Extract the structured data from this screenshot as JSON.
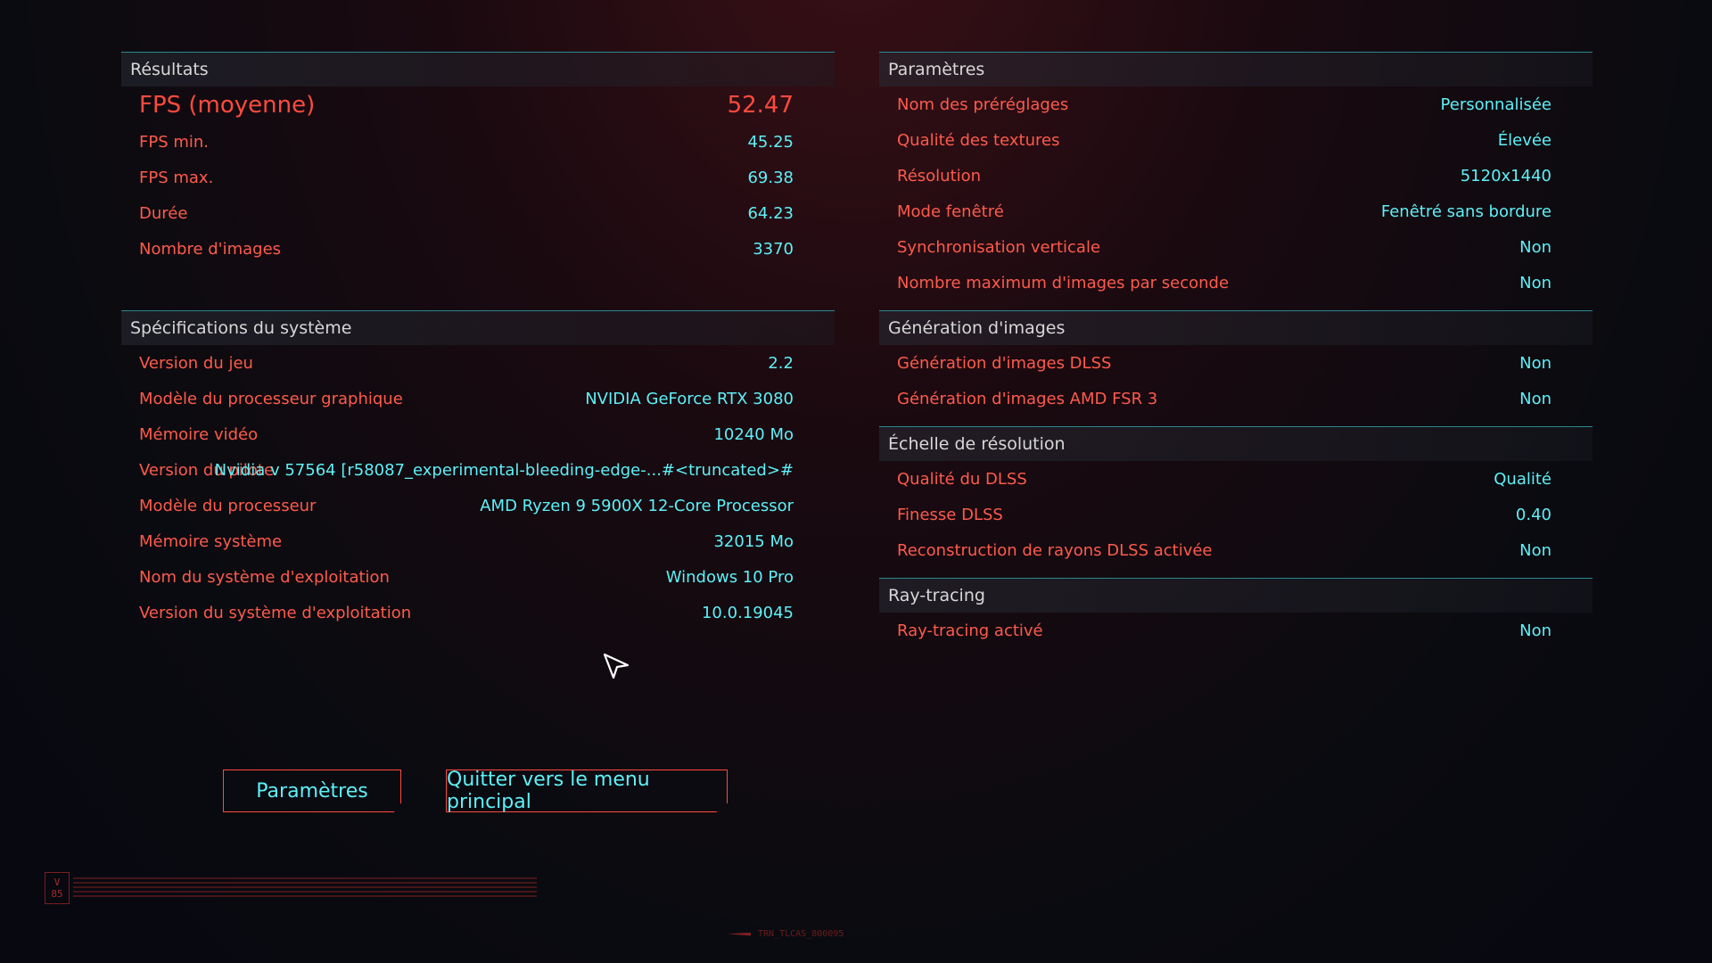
{
  "results": {
    "title": "Résultats",
    "rows": [
      {
        "label": "FPS (moyenne)",
        "value": "52.47"
      },
      {
        "label": "FPS min.",
        "value": "45.25"
      },
      {
        "label": "FPS max.",
        "value": "69.38"
      },
      {
        "label": "Durée",
        "value": "64.23"
      },
      {
        "label": "Nombre d'images",
        "value": "3370"
      }
    ]
  },
  "system": {
    "title": "Spécifications du système",
    "rows": [
      {
        "label": "Version du jeu",
        "value": "2.2"
      },
      {
        "label": "Modèle du processeur graphique",
        "value": "NVIDIA GeForce RTX 3080"
      },
      {
        "label": "Mémoire vidéo",
        "value": "10240 Mo"
      },
      {
        "label": "Version du pilote",
        "value": "Nvidia v 57564 [r58087_experimental-bleeding-edge-...#<truncated>#"
      },
      {
        "label": "Modèle du processeur",
        "value": "AMD Ryzen 9 5900X 12-Core Processor"
      },
      {
        "label": "Mémoire système",
        "value": "32015 Mo"
      },
      {
        "label": "Nom du système d'exploitation",
        "value": "Windows 10 Pro"
      },
      {
        "label": "Version du système d'exploitation",
        "value": "10.0.19045"
      }
    ]
  },
  "settings": {
    "title": "Paramètres",
    "rows": [
      {
        "label": "Nom des préréglages",
        "value": "Personnalisée"
      },
      {
        "label": "Qualité des textures",
        "value": "Élevée"
      },
      {
        "label": "Résolution",
        "value": "5120x1440"
      },
      {
        "label": "Mode fenêtré",
        "value": "Fenêtré sans bordure"
      },
      {
        "label": "Synchronisation verticale",
        "value": "Non"
      },
      {
        "label": "Nombre maximum d'images par seconde",
        "value": "Non"
      }
    ]
  },
  "frame_gen": {
    "title": "Génération d'images",
    "rows": [
      {
        "label": "Génération d'images DLSS",
        "value": "Non"
      },
      {
        "label": "Génération d'images AMD FSR 3",
        "value": "Non"
      }
    ]
  },
  "scaling": {
    "title": "Échelle de résolution",
    "rows": [
      {
        "label": "Qualité du DLSS",
        "value": "Qualité"
      },
      {
        "label": "Finesse DLSS",
        "value": "0.40"
      },
      {
        "label": "Reconstruction de rayons DLSS activée",
        "value": "Non"
      }
    ]
  },
  "raytracing": {
    "title": "Ray-tracing",
    "rows": [
      {
        "label": "Ray-tracing activé",
        "value": "Non"
      }
    ]
  },
  "buttons": {
    "settings_label": "Paramètres",
    "quit_label": "Quitter vers le menu principal"
  },
  "decor": {
    "badge_top": "V",
    "badge_bottom": "85",
    "footer_code": "TRN_TLCAS_800095"
  },
  "colors": {
    "label": "#ff5a4c",
    "value": "#5ef0f7",
    "accent_line": "#2a8891"
  }
}
